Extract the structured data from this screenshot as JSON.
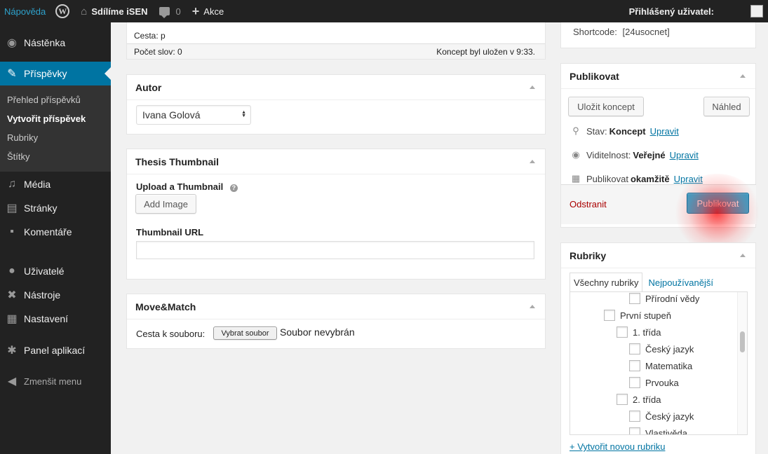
{
  "adminbar": {
    "help": "Nápověda",
    "site_name": "Sdílíme iSEN",
    "comments_count": "0",
    "new_label": "Akce",
    "user_label": "Přihlášený uživatel:"
  },
  "sidebar": {
    "items": [
      {
        "label": "Nástěnka",
        "icon": "dashboard-icon"
      },
      {
        "label": "Příspěvky",
        "icon": "pin-icon"
      },
      {
        "label": "Média",
        "icon": "media-icon"
      },
      {
        "label": "Stránky",
        "icon": "pages-icon"
      },
      {
        "label": "Komentáře",
        "icon": "comments-icon"
      },
      {
        "label": "Uživatelé",
        "icon": "users-icon"
      },
      {
        "label": "Nástroje",
        "icon": "wrench-icon"
      },
      {
        "label": "Nastavení",
        "icon": "settings-icon"
      },
      {
        "label": "Panel aplikací",
        "icon": "gear-icon"
      }
    ],
    "submenu": [
      "Přehled příspěvků",
      "Vytvořit příspěvek",
      "Rubriky",
      "Štítky"
    ],
    "collapse": "Zmenšit menu"
  },
  "editor": {
    "path": "Cesta: p",
    "word_count": "Počet slov: 0",
    "autosave": "Koncept byl uložen v 9:33."
  },
  "author_box": {
    "title": "Autor",
    "selected": "Ivana Golová"
  },
  "thumbnail_box": {
    "title": "Thesis Thumbnail",
    "upload_label": "Upload a Thumbnail",
    "add_image": "Add Image",
    "url_label": "Thumbnail URL",
    "url_value": ""
  },
  "movematch_box": {
    "title": "Move&Match",
    "path_label": "Cesta k souboru:",
    "choose_file": "Vybrat soubor",
    "no_file": "Soubor nevybrán"
  },
  "shortcode_box": {
    "label": "Shortcode:",
    "value": "[24usocnet]"
  },
  "publish_box": {
    "title": "Publikovat",
    "save_draft": "Uložit koncept",
    "preview": "Náhled",
    "status_label": "Stav:",
    "status_value": "Koncept",
    "visibility_label": "Viditelnost:",
    "visibility_value": "Veřejné",
    "publish_label": "Publikovat",
    "publish_value": "okamžitě",
    "edit": "Upravit",
    "delete": "Odstranit",
    "publish_button": "Publikovat"
  },
  "categories_box": {
    "title": "Rubriky",
    "tab_all": "Všechny rubriky",
    "tab_popular": "Nejpoužívanější",
    "items": [
      "Přírodní vědy",
      "První stupeň",
      "1. třída",
      "Český jazyk",
      "Matematika",
      "Prvouka",
      "2. třída",
      "Český jazyk",
      "Vlastivěda"
    ],
    "add_new": "+ Vytvořit novou rubriku"
  }
}
